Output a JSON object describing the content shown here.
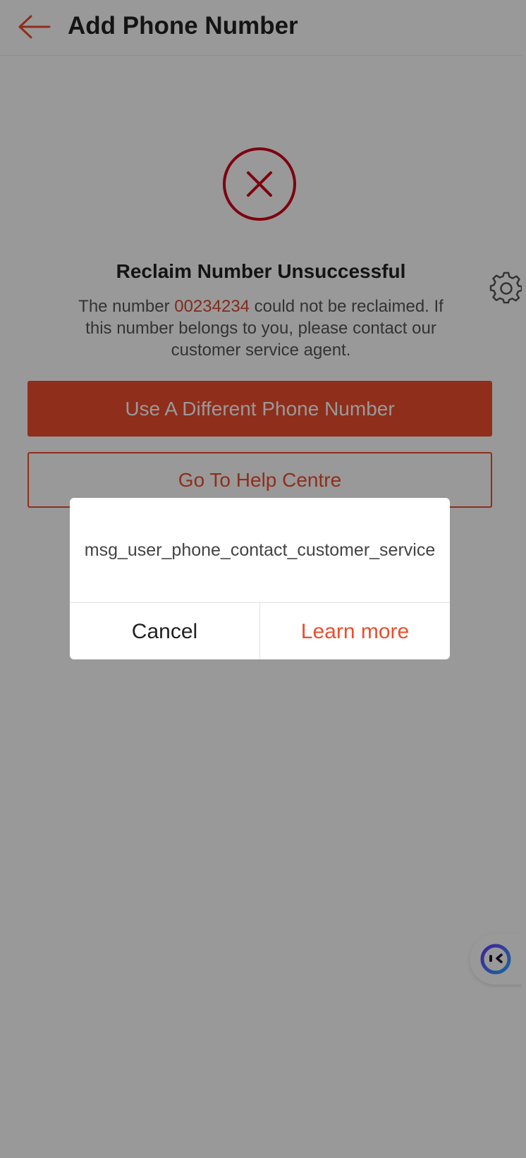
{
  "header": {
    "title": "Add Phone Number",
    "back_icon": "arrow-left-icon"
  },
  "result": {
    "icon": "close-circle-icon",
    "title": "Reclaim Number Unsuccessful",
    "desc_prefix": "The number ",
    "number": "00234234",
    "desc_suffix": " could not be reclaimed. If this number belongs to you, please contact our customer service agent."
  },
  "actions": {
    "primary_label": "Use A Different Phone Number",
    "secondary_label": "Go To Help Centre"
  },
  "floating": {
    "settings_icon": "gear-icon",
    "chatbot_icon": "chatbot-icon"
  },
  "dialog": {
    "message": "msg_user_phone_contact_customer_service",
    "cancel_label": "Cancel",
    "confirm_label": "Learn more"
  },
  "colors": {
    "brand": "#ee4d2d",
    "error": "#d0011b",
    "overlay": "rgba(0,0,0,0.4)"
  }
}
